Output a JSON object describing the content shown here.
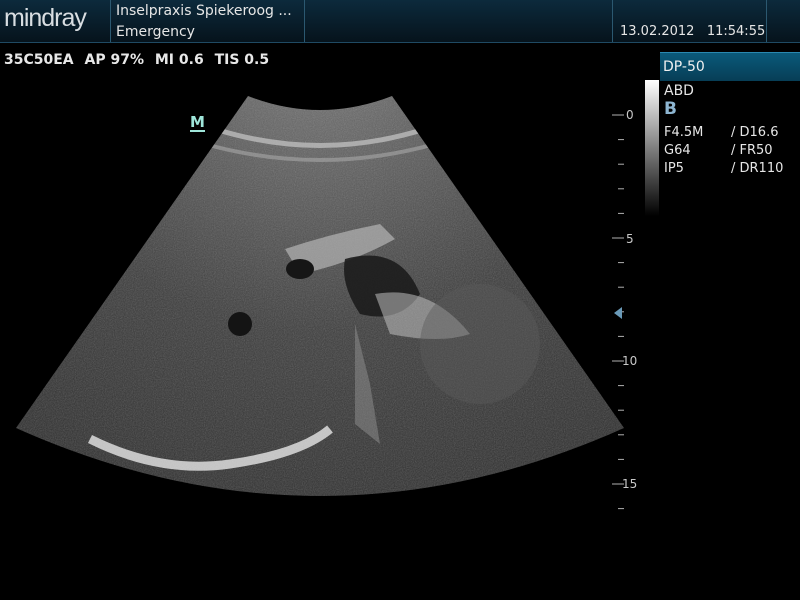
{
  "header": {
    "logo": "mindray",
    "clinic": "Inselpraxis Spiekeroog ...",
    "exam_preset": "Emergency",
    "date": "13.02.2012",
    "time": "11:54:55"
  },
  "probe_info": {
    "probe": "35C50EA",
    "ap": "AP 97%",
    "mi": "MI 0.6",
    "tis": "TIS 0.5"
  },
  "side_panel": {
    "title": "DP-50",
    "exam": "ABD",
    "mode": "B",
    "params": [
      {
        "left": "F4.5M",
        "right": "/ D16.6"
      },
      {
        "left": "G64",
        "right": "/ FR50"
      },
      {
        "left": "IP5",
        "right": "/ DR110"
      }
    ]
  },
  "image": {
    "orientation_marker": "M",
    "depth_labels": [
      "0",
      "5",
      "10",
      "15"
    ]
  }
}
